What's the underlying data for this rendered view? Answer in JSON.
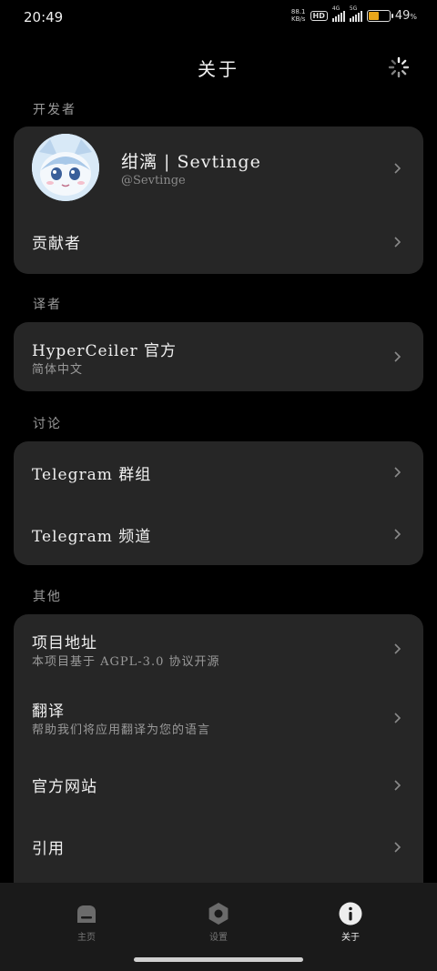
{
  "status_bar": {
    "time": "20:49",
    "net_speed_value": "88.1",
    "net_speed_unit": "KB/s",
    "hd_label": "HD",
    "signal1_label": "4G",
    "signal2_label": "5G",
    "battery_percent": "49",
    "battery_symbol": "%",
    "battery_level": 0.49,
    "battery_color": "#e9a61a"
  },
  "header": {
    "title": "关于",
    "loading_icon": "loading-spinner-icon"
  },
  "sections": {
    "developer": {
      "header": "开发者",
      "name": "绀漓 | Sevtinge",
      "handle": "@Sevtinge",
      "contributors": "贡献者"
    },
    "translator": {
      "header": "译者",
      "title": "HyperCeiler 官方",
      "subtitle": "简体中文"
    },
    "discussion": {
      "header": "讨论",
      "items": [
        {
          "title": "Telegram 群组"
        },
        {
          "title": "Telegram 频道"
        }
      ]
    },
    "other": {
      "header": "其他",
      "items": [
        {
          "title": "项目地址",
          "subtitle": "本项目基于 AGPL-3.0 协议开源"
        },
        {
          "title": "翻译",
          "subtitle": "帮助我们将应用翻译为您的语言"
        },
        {
          "title": "官方网站"
        },
        {
          "title": "引用"
        }
      ]
    }
  },
  "bottom_nav": {
    "items": [
      {
        "label": "主页",
        "icon": "home-icon"
      },
      {
        "label": "设置",
        "icon": "settings-icon"
      },
      {
        "label": "关于",
        "icon": "info-icon",
        "active": true
      }
    ]
  },
  "colors": {
    "background": "#000000",
    "card": "#262626",
    "text_primary": "#f0f0f0",
    "text_secondary": "#9a9a9a"
  }
}
